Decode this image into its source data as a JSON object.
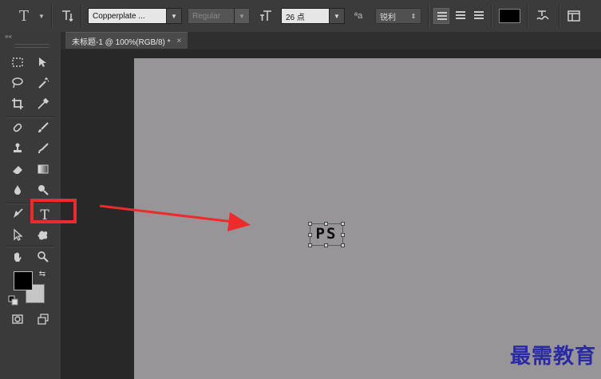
{
  "options_bar": {
    "tool_icon": "T",
    "orientation_icon": "text-orientation-icon",
    "font_family": "Copperplate ...",
    "font_style": "Regular",
    "font_size": "26 点",
    "aa_icon": "ªa",
    "antialias": "锐利",
    "text_color": "#000000"
  },
  "document_tab": {
    "title": "未标题-1 @ 100%(RGB/8) *",
    "close": "×"
  },
  "canvas": {
    "text": "PS",
    "background": "#979598"
  },
  "toolbar": {
    "collapse": "««",
    "type_tool_glyph": "T",
    "foreground_color": "#000000",
    "background_color": "#c6c6c6"
  },
  "annotation": {
    "highlight_color": "#ee2b2b",
    "arrow_color": "#ee2b2b"
  },
  "watermark": "最需教育"
}
